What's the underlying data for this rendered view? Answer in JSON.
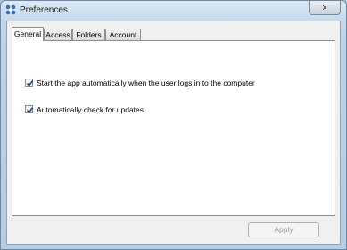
{
  "window": {
    "title": "Preferences",
    "close_glyph": "x"
  },
  "tabs": [
    {
      "label": "General",
      "active": true
    },
    {
      "label": "Access",
      "active": false
    },
    {
      "label": "Folders",
      "active": false
    },
    {
      "label": "Account",
      "active": false
    }
  ],
  "general": {
    "options": [
      {
        "label": "Start the app automatically when the user logs in to the computer",
        "checked": true
      },
      {
        "label": "Automatically check for updates",
        "checked": true
      }
    ]
  },
  "footer": {
    "apply_label": "Apply",
    "apply_enabled": false
  },
  "colors": {
    "check": "#1f3f78",
    "app_icon": "#3b6fb5"
  }
}
